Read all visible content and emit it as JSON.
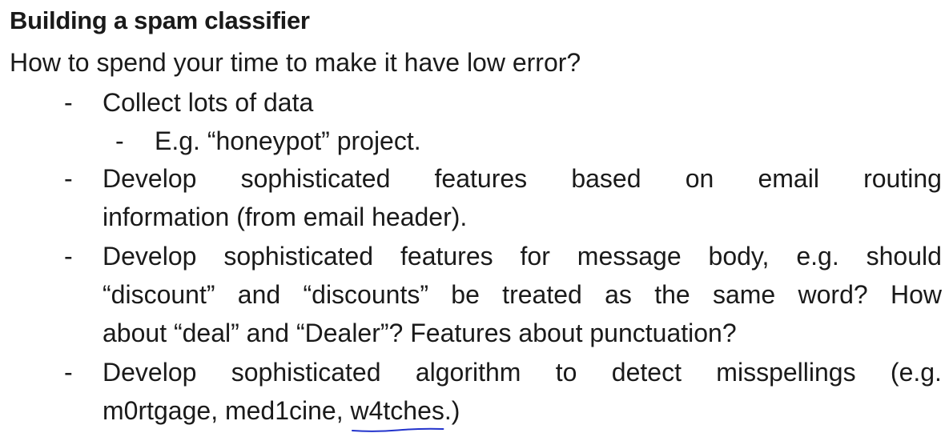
{
  "slide": {
    "title": "Building a spam classifier",
    "question": "How to spend your time to make it have low error?",
    "bullet_marker": "-",
    "bullets": [
      {
        "lines": [
          "Collect lots of data"
        ]
      },
      {
        "sub": true,
        "lines": [
          "E.g. “honeypot” project."
        ]
      },
      {
        "lines": [
          [
            "Develop",
            "sophisticated",
            "features",
            "based",
            "on",
            "email",
            "routing"
          ],
          "information (from email header)."
        ]
      },
      {
        "lines": [
          [
            "Develop",
            "sophisticated",
            "features",
            "for",
            "message",
            "body,",
            "e.g.",
            "should"
          ],
          [
            "“discount”",
            "and",
            "“discounts”",
            "be",
            "treated",
            "as",
            "the",
            "same",
            "word?",
            "How"
          ],
          "about “deal” and “Dealer”? Features about punctuation?"
        ]
      },
      {
        "lines": [
          [
            "Develop",
            "sophisticated",
            "algorithm",
            "to",
            "detect",
            "misspellings",
            "(e.g."
          ],
          {
            "before": "m0rtgage, med1cine, ",
            "underlined": "w4tches",
            "after": ".)"
          }
        ]
      }
    ],
    "annotation_color": "#2233cc"
  }
}
